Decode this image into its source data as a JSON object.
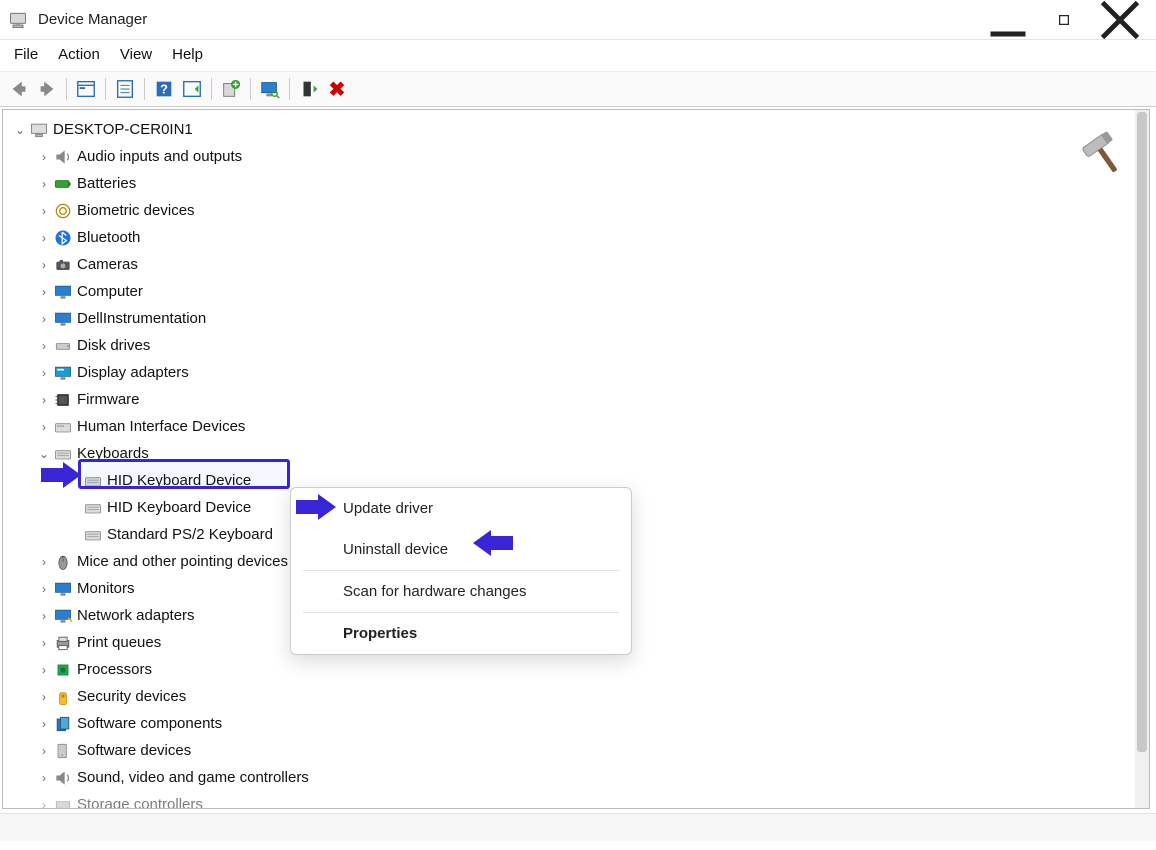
{
  "window": {
    "title": "Device Manager"
  },
  "menu": {
    "file": "File",
    "action": "Action",
    "view": "View",
    "help": "Help"
  },
  "tree": {
    "root": "DESKTOP-CER0IN1",
    "categories": [
      {
        "label": "Audio inputs and outputs"
      },
      {
        "label": "Batteries"
      },
      {
        "label": "Biometric devices"
      },
      {
        "label": "Bluetooth"
      },
      {
        "label": "Cameras"
      },
      {
        "label": "Computer"
      },
      {
        "label": "DellInstrumentation"
      },
      {
        "label": "Disk drives"
      },
      {
        "label": "Display adapters"
      },
      {
        "label": "Firmware"
      },
      {
        "label": "Human Interface Devices"
      },
      {
        "label": "Keyboards",
        "expanded": true,
        "children": [
          {
            "label": "HID Keyboard Device",
            "selected": true
          },
          {
            "label": "HID Keyboard Device"
          },
          {
            "label": "Standard PS/2 Keyboard"
          }
        ]
      },
      {
        "label": "Mice and other pointing devices"
      },
      {
        "label": "Monitors"
      },
      {
        "label": "Network adapters"
      },
      {
        "label": "Print queues"
      },
      {
        "label": "Processors"
      },
      {
        "label": "Security devices"
      },
      {
        "label": "Software components"
      },
      {
        "label": "Software devices"
      },
      {
        "label": "Sound, video and game controllers"
      },
      {
        "label": "Storage controllers"
      }
    ]
  },
  "context_menu": {
    "update": "Update driver",
    "uninstall": "Uninstall device",
    "scan": "Scan for hardware changes",
    "props": "Properties"
  }
}
